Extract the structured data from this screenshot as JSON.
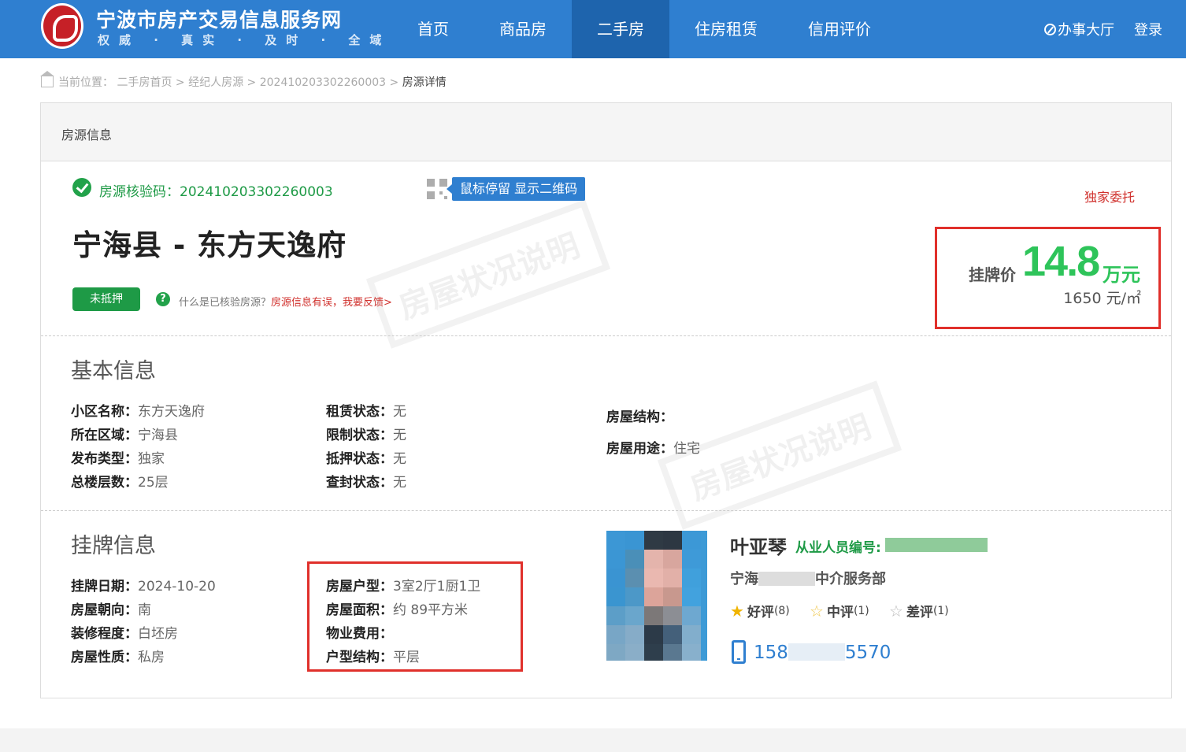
{
  "header": {
    "site_title": "宁波市房产交易信息服务网",
    "slogan": "权威 · 真实 · 及时 · 全域",
    "nav": [
      {
        "label": "首页"
      },
      {
        "label": "商品房"
      },
      {
        "label": "二手房",
        "active": true
      },
      {
        "label": "住房租赁"
      },
      {
        "label": "信用评价"
      }
    ],
    "hall_label": "办事大厅",
    "login_label": "登录"
  },
  "breadcrumb": {
    "prefix": "当前位置：",
    "items": [
      "二手房首页",
      "经纪人房源",
      "202410203302260003"
    ],
    "current": "房源详情",
    "separator": ">"
  },
  "card": {
    "head_title": "房源信息",
    "verify_text": "房源核验码：202410203302260003",
    "qr_tip": "鼠标停留 显示二维码",
    "exclusive": "独家委托",
    "title": "宁海县 - 东方天逸府",
    "mortgage_badge": "未抵押",
    "help_text": "什么是已核验房源？",
    "help_link": "房源信息有误，我要反馈>"
  },
  "price": {
    "label": "挂牌价",
    "amount": "14.8",
    "unit": "万元",
    "per_sqm": "1650 元/㎡"
  },
  "basic": {
    "title": "基本信息",
    "col1": [
      {
        "k": "小区名称：",
        "v": "东方天逸府"
      },
      {
        "k": "所在区域：",
        "v": "宁海县"
      },
      {
        "k": "发布类型：",
        "v": "独家"
      },
      {
        "k": "总楼层数：",
        "v": "25层"
      }
    ],
    "col2": [
      {
        "k": "租赁状态：",
        "v": "无"
      },
      {
        "k": "限制状态：",
        "v": "无"
      },
      {
        "k": "抵押状态：",
        "v": "无"
      },
      {
        "k": "查封状态：",
        "v": "无"
      }
    ],
    "col3": [
      {
        "k": "房屋结构：",
        "v": ""
      },
      {
        "k": "房屋用途：",
        "v": "住宅"
      }
    ]
  },
  "listing": {
    "title": "挂牌信息",
    "col1": [
      {
        "k": "挂牌日期：",
        "v": "2024-10-20"
      },
      {
        "k": "房屋朝向：",
        "v": "南"
      },
      {
        "k": "装修程度：",
        "v": "白坯房"
      },
      {
        "k": "房屋性质：",
        "v": "私房"
      }
    ],
    "col2": [
      {
        "k": "房屋户型：",
        "v": "3室2厅1厨1卫"
      },
      {
        "k": "房屋面积：",
        "v": "约 89平方米"
      },
      {
        "k": "物业费用：",
        "v": ""
      },
      {
        "k": "户型结构：",
        "v": "平层"
      }
    ]
  },
  "agent": {
    "name": "叶亚琴",
    "id_label": "从业人员编号:",
    "company_prefix": "宁海",
    "company_suffix": "中介服务部",
    "good_label": "好评",
    "good_count": "(8)",
    "mid_label": "中评",
    "mid_count": "(1)",
    "bad_label": "差评",
    "bad_count": "(1)",
    "phone_prefix": "158",
    "phone_suffix": "5570"
  },
  "watermark": "房屋状况说明",
  "colors": {
    "header_blue": "#2f7fd0",
    "active_nav": "#1e64ad",
    "green": "#1e9a46",
    "price_green": "#2ec45a",
    "red": "#e0302b"
  }
}
